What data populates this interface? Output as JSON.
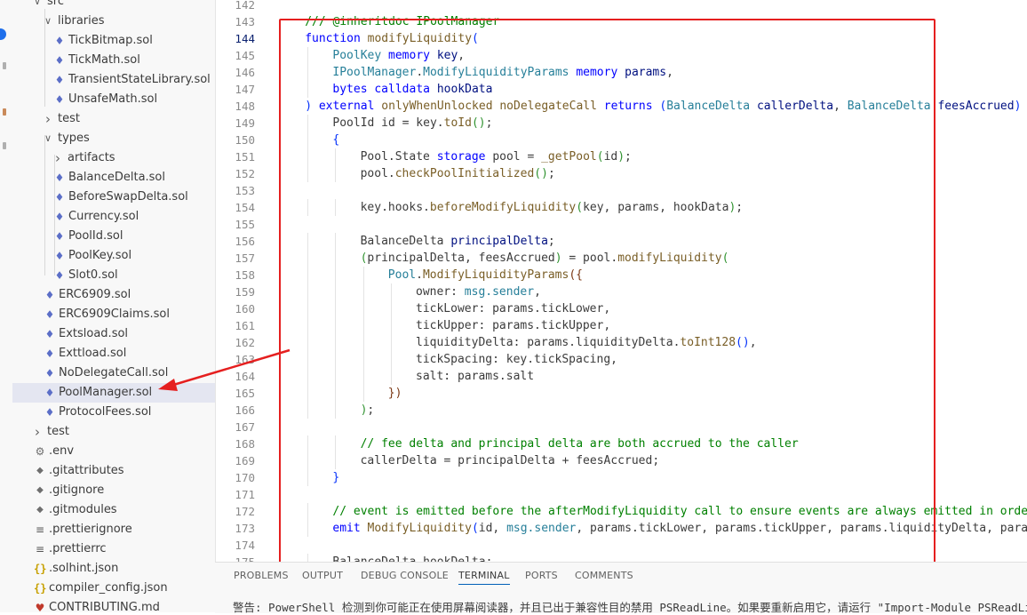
{
  "explorer": {
    "rows": [
      {
        "label": "src",
        "indent": 1,
        "chevron": "open",
        "icon": ""
      },
      {
        "label": "libraries",
        "indent": 2,
        "chevron": "open",
        "icon": ""
      },
      {
        "label": "TickBitmap.sol",
        "indent": 3,
        "chevron": "",
        "icon": "sol"
      },
      {
        "label": "TickMath.sol",
        "indent": 3,
        "chevron": "",
        "icon": "sol"
      },
      {
        "label": "TransientStateLibrary.sol",
        "indent": 3,
        "chevron": "",
        "icon": "sol"
      },
      {
        "label": "UnsafeMath.sol",
        "indent": 3,
        "chevron": "",
        "icon": "sol"
      },
      {
        "label": "test",
        "indent": 2,
        "chevron": "closed",
        "icon": ""
      },
      {
        "label": "types",
        "indent": 2,
        "chevron": "open",
        "icon": ""
      },
      {
        "label": "artifacts",
        "indent": 3,
        "chevron": "closed",
        "icon": ""
      },
      {
        "label": "BalanceDelta.sol",
        "indent": 3,
        "chevron": "",
        "icon": "sol"
      },
      {
        "label": "BeforeSwapDelta.sol",
        "indent": 3,
        "chevron": "",
        "icon": "sol"
      },
      {
        "label": "Currency.sol",
        "indent": 3,
        "chevron": "",
        "icon": "sol"
      },
      {
        "label": "PoolId.sol",
        "indent": 3,
        "chevron": "",
        "icon": "sol"
      },
      {
        "label": "PoolKey.sol",
        "indent": 3,
        "chevron": "",
        "icon": "sol"
      },
      {
        "label": "Slot0.sol",
        "indent": 3,
        "chevron": "",
        "icon": "sol"
      },
      {
        "label": "ERC6909.sol",
        "indent": 2,
        "chevron": "",
        "icon": "sol"
      },
      {
        "label": "ERC6909Claims.sol",
        "indent": 2,
        "chevron": "",
        "icon": "sol"
      },
      {
        "label": "Extsload.sol",
        "indent": 2,
        "chevron": "",
        "icon": "sol"
      },
      {
        "label": "Exttload.sol",
        "indent": 2,
        "chevron": "",
        "icon": "sol"
      },
      {
        "label": "NoDelegateCall.sol",
        "indent": 2,
        "chevron": "",
        "icon": "sol"
      },
      {
        "label": "PoolManager.sol",
        "indent": 2,
        "chevron": "",
        "icon": "sol",
        "selected": true
      },
      {
        "label": "ProtocolFees.sol",
        "indent": 2,
        "chevron": "",
        "icon": "sol"
      },
      {
        "label": "test",
        "indent": 1,
        "chevron": "closed",
        "icon": ""
      },
      {
        "label": ".env",
        "indent": 1,
        "chevron": "",
        "icon": "gear"
      },
      {
        "label": ".gitattributes",
        "indent": 1,
        "chevron": "",
        "icon": "git"
      },
      {
        "label": ".gitignore",
        "indent": 1,
        "chevron": "",
        "icon": "git"
      },
      {
        "label": ".gitmodules",
        "indent": 1,
        "chevron": "",
        "icon": "git"
      },
      {
        "label": ".prettierignore",
        "indent": 1,
        "chevron": "",
        "icon": "lines"
      },
      {
        "label": ".prettierrc",
        "indent": 1,
        "chevron": "",
        "icon": "lines"
      },
      {
        "label": ".solhint.json",
        "indent": 1,
        "chevron": "",
        "icon": "json"
      },
      {
        "label": "compiler_config.json",
        "indent": 1,
        "chevron": "",
        "icon": "json"
      },
      {
        "label": "CONTRIBUTING.md",
        "indent": 1,
        "chevron": "",
        "icon": "md"
      }
    ]
  },
  "editor": {
    "active_line": "144",
    "lines": [
      {
        "n": "142",
        "indent": 0,
        "tokens": []
      },
      {
        "n": "143",
        "indent": 1,
        "tokens": [
          [
            "cm",
            "/// @inheritdoc IPoolManager"
          ]
        ]
      },
      {
        "n": "144",
        "indent": 1,
        "tokens": [
          [
            "kw",
            "function "
          ],
          [
            "fn",
            "modifyLiquidity"
          ],
          [
            "p1",
            "("
          ]
        ]
      },
      {
        "n": "145",
        "indent": 2,
        "tokens": [
          [
            "ty",
            "PoolKey "
          ],
          [
            "kw",
            "memory "
          ],
          [
            "var",
            "key"
          ],
          [
            "id",
            ","
          ]
        ]
      },
      {
        "n": "146",
        "indent": 2,
        "tokens": [
          [
            "ty",
            "IPoolManager"
          ],
          [
            "id",
            "."
          ],
          [
            "ty",
            "ModifyLiquidityParams "
          ],
          [
            "kw",
            "memory "
          ],
          [
            "var",
            "params"
          ],
          [
            "id",
            ","
          ]
        ]
      },
      {
        "n": "147",
        "indent": 2,
        "tokens": [
          [
            "kw",
            "bytes "
          ],
          [
            "kw",
            "calldata "
          ],
          [
            "var",
            "hookData"
          ]
        ]
      },
      {
        "n": "148",
        "indent": 1,
        "tokens": [
          [
            "p1",
            ") "
          ],
          [
            "kw",
            "external "
          ],
          [
            "fn",
            "onlyWhenUnlocked "
          ],
          [
            "fn",
            "noDelegateCall "
          ],
          [
            "kw",
            "returns "
          ],
          [
            "p1",
            "("
          ],
          [
            "ty",
            "BalanceDelta "
          ],
          [
            "var",
            "callerDelta"
          ],
          [
            "id",
            ", "
          ],
          [
            "ty",
            "BalanceDelta "
          ],
          [
            "var",
            "feesAccrued"
          ],
          [
            "p1",
            ") "
          ],
          [
            "id",
            "{"
          ]
        ]
      },
      {
        "n": "149",
        "indent": 2,
        "tokens": [
          [
            "id",
            "PoolId id = key."
          ],
          [
            "fn",
            "toId"
          ],
          [
            "p2",
            "()"
          ],
          [
            "id",
            ";"
          ]
        ]
      },
      {
        "n": "150",
        "indent": 2,
        "tokens": [
          [
            "p1",
            "{"
          ]
        ]
      },
      {
        "n": "151",
        "indent": 3,
        "tokens": [
          [
            "id",
            "Pool.State "
          ],
          [
            "kw",
            "storage "
          ],
          [
            "id",
            "pool = "
          ],
          [
            "fn",
            "_getPool"
          ],
          [
            "p2",
            "("
          ],
          [
            "id",
            "id"
          ],
          [
            "p2",
            ")"
          ],
          [
            "id",
            ";"
          ]
        ]
      },
      {
        "n": "152",
        "indent": 3,
        "tokens": [
          [
            "id",
            "pool."
          ],
          [
            "fn",
            "checkPoolInitialized"
          ],
          [
            "p2",
            "()"
          ],
          [
            "id",
            ";"
          ]
        ]
      },
      {
        "n": "153",
        "indent": 0,
        "tokens": []
      },
      {
        "n": "154",
        "indent": 3,
        "tokens": [
          [
            "id",
            "key.hooks."
          ],
          [
            "fn",
            "beforeModifyLiquidity"
          ],
          [
            "p2",
            "("
          ],
          [
            "id",
            "key, params, hookData"
          ],
          [
            "p2",
            ")"
          ],
          [
            "id",
            ";"
          ]
        ]
      },
      {
        "n": "155",
        "indent": 0,
        "tokens": []
      },
      {
        "n": "156",
        "indent": 3,
        "tokens": [
          [
            "id",
            "BalanceDelta "
          ],
          [
            "var",
            "principalDelta"
          ],
          [
            "id",
            ";"
          ]
        ]
      },
      {
        "n": "157",
        "indent": 3,
        "tokens": [
          [
            "p2",
            "("
          ],
          [
            "id",
            "principalDelta, feesAccrued"
          ],
          [
            "p2",
            ")"
          ],
          [
            "id",
            " = pool."
          ],
          [
            "fn",
            "modifyLiquidity"
          ],
          [
            "p2",
            "("
          ]
        ]
      },
      {
        "n": "158",
        "indent": 4,
        "tokens": [
          [
            "ty",
            "Pool"
          ],
          [
            "id",
            "."
          ],
          [
            "fn",
            "ModifyLiquidityParams"
          ],
          [
            "p3",
            "({"
          ]
        ]
      },
      {
        "n": "159",
        "indent": 5,
        "tokens": [
          [
            "id",
            "owner: "
          ],
          [
            "t2",
            "msg.sender"
          ],
          [
            "id",
            ","
          ]
        ]
      },
      {
        "n": "160",
        "indent": 5,
        "tokens": [
          [
            "id",
            "tickLower: params.tickLower,"
          ]
        ]
      },
      {
        "n": "161",
        "indent": 5,
        "tokens": [
          [
            "id",
            "tickUpper: params.tickUpper,"
          ]
        ]
      },
      {
        "n": "162",
        "indent": 5,
        "tokens": [
          [
            "id",
            "liquidityDelta: params.liquidityDelta."
          ],
          [
            "fn",
            "toInt128"
          ],
          [
            "p1",
            "()"
          ],
          [
            "id",
            ","
          ]
        ]
      },
      {
        "n": "163",
        "indent": 5,
        "tokens": [
          [
            "id",
            "tickSpacing: key.tickSpacing,"
          ]
        ]
      },
      {
        "n": "164",
        "indent": 5,
        "tokens": [
          [
            "id",
            "salt: params.salt"
          ]
        ]
      },
      {
        "n": "165",
        "indent": 4,
        "tokens": [
          [
            "p3",
            "})"
          ]
        ]
      },
      {
        "n": "166",
        "indent": 3,
        "tokens": [
          [
            "p2",
            ")"
          ],
          [
            "id",
            ";"
          ]
        ]
      },
      {
        "n": "167",
        "indent": 0,
        "tokens": []
      },
      {
        "n": "168",
        "indent": 3,
        "tokens": [
          [
            "cm",
            "// fee delta and principal delta are both accrued to the caller"
          ]
        ]
      },
      {
        "n": "169",
        "indent": 3,
        "tokens": [
          [
            "id",
            "callerDelta = principalDelta + feesAccrued;"
          ]
        ]
      },
      {
        "n": "170",
        "indent": 2,
        "tokens": [
          [
            "p1",
            "}"
          ]
        ]
      },
      {
        "n": "171",
        "indent": 0,
        "tokens": []
      },
      {
        "n": "172",
        "indent": 2,
        "tokens": [
          [
            "cm",
            "// event is emitted before the afterModifyLiquidity call to ensure events are always emitted in order"
          ]
        ]
      },
      {
        "n": "173",
        "indent": 2,
        "tokens": [
          [
            "kw",
            "emit "
          ],
          [
            "fn",
            "ModifyLiquidity"
          ],
          [
            "p1",
            "("
          ],
          [
            "id",
            "id, "
          ],
          [
            "t2",
            "msg.sender"
          ],
          [
            "id",
            ", params.tickLower, params.tickUpper, params.liquidityDelta, params.salt"
          ],
          [
            "p1",
            ")"
          ],
          [
            "id",
            ";"
          ]
        ]
      },
      {
        "n": "174",
        "indent": 0,
        "tokens": []
      },
      {
        "n": "175",
        "indent": 2,
        "tokens": [
          [
            "id",
            "BalanceDelta hookDelta;"
          ]
        ]
      }
    ]
  },
  "panel": {
    "tabs": [
      "PROBLEMS",
      "OUTPUT",
      "DEBUG CONSOLE",
      "TERMINAL",
      "PORTS",
      "COMMENTS"
    ],
    "active_tab": "TERMINAL",
    "terminal_text": "警告: PowerShell 检测到你可能正在使用屏幕阅读器，并且已出于兼容性目的禁用 PSReadLine。如果要重新启用它，请运行 \"Import-Module PSReadLine\"。"
  },
  "colors": {
    "keyword": "#0000ff",
    "type": "#267f99",
    "function": "#795e26",
    "variable": "#001080",
    "comment": "#008000",
    "annotation": "#e51f1f",
    "selection": "#e4e6f1"
  }
}
